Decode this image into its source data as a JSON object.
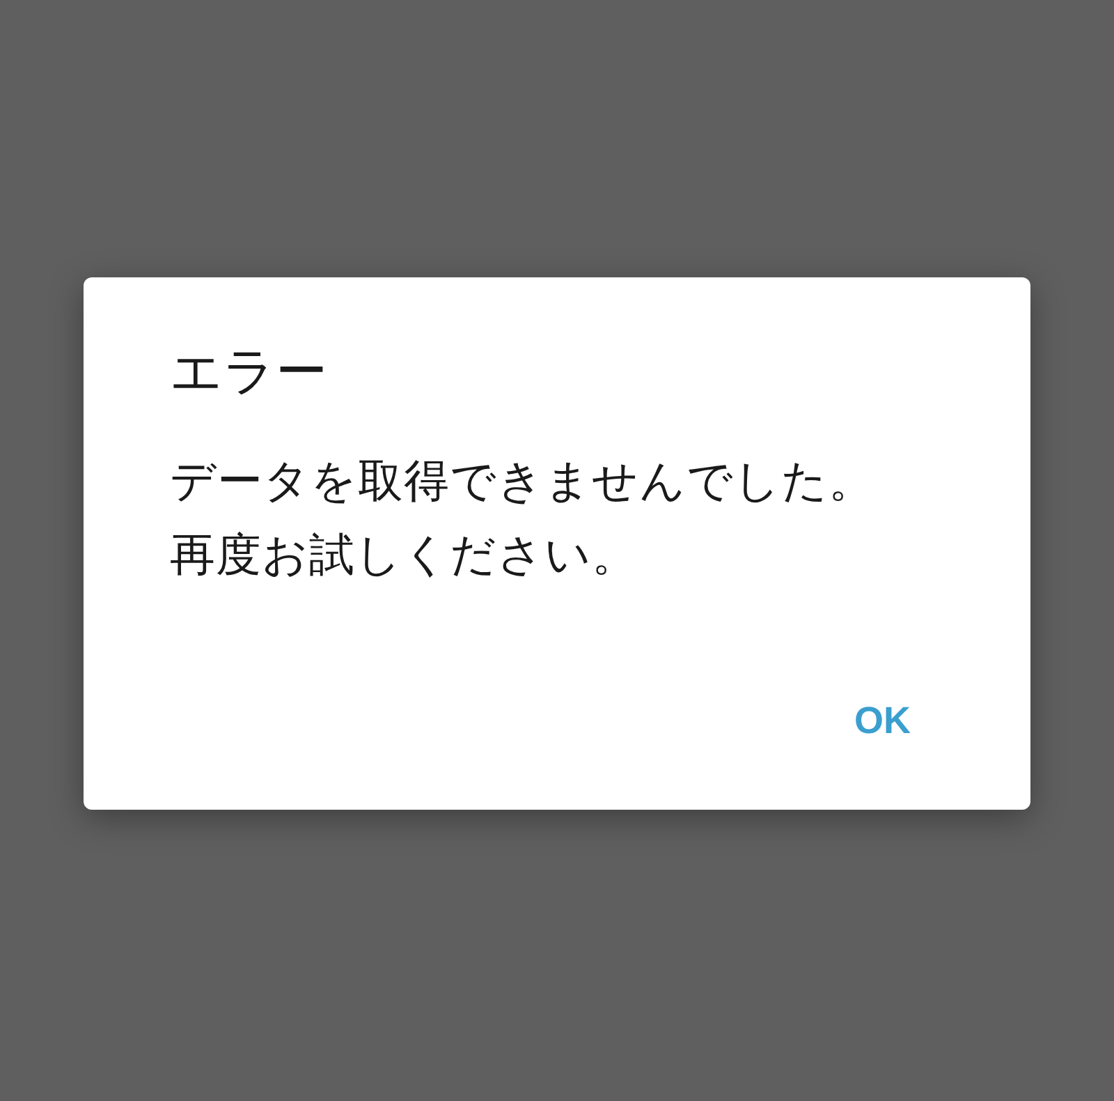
{
  "dialog": {
    "title": "エラー",
    "message_lines": [
      "データを取得できませんでした。",
      "再度お試しください。"
    ],
    "buttons": [
      {
        "label": "OK",
        "kind": "text"
      }
    ]
  }
}
